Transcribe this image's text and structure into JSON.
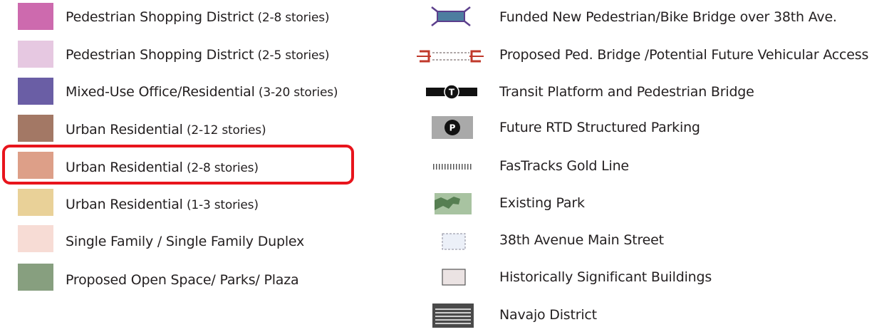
{
  "legend": {
    "left_items": [
      {
        "label": "Pedestrian Shopping District",
        "detail": " (2-8 stories)",
        "color": "#cd6aae"
      },
      {
        "label": "Pedestrian Shopping District",
        "detail": " (2-5 stories)",
        "color": "#e6c8e1"
      },
      {
        "label": "Mixed-Use Office/Residential",
        "detail": " (3-20 stories)",
        "color": "#6a5ea5"
      },
      {
        "label": "Urban Residential",
        "detail": " (2-12 stories)",
        "color": "#a37865"
      },
      {
        "label": "Urban Residential",
        "detail": " (2-8 stories)",
        "color": "#dd9f88"
      },
      {
        "label": "Urban Residential",
        "detail": " (1-3 stories)",
        "color": "#e9d198"
      },
      {
        "label": "Single Family / Single Family Duplex",
        "detail": "",
        "color": "#f7dcd5"
      },
      {
        "label": "Proposed Open Space/ Parks/ Plaza",
        "detail": "",
        "color": "#879f7f"
      }
    ],
    "right_items": [
      {
        "label": "Funded New Pedestrian/Bike Bridge over 38th Ave.",
        "icon": "bridge-icon"
      },
      {
        "label": "Proposed Ped. Bridge /Potential Future Vehicular Access",
        "icon": "proposed-bridge-icon"
      },
      {
        "label": "Transit Platform and Pedestrian Bridge",
        "icon": "transit-platform-icon",
        "icon_text": "T"
      },
      {
        "label": "Future RTD Structured Parking",
        "icon": "parking-icon",
        "icon_text": "P"
      },
      {
        "label": "FasTracks Gold Line",
        "icon": "rail-line-icon"
      },
      {
        "label": "Existing Park",
        "icon": "park-icon"
      },
      {
        "label": "38th Avenue Main Street",
        "icon": "main-street-icon"
      },
      {
        "label": "Historically Significant Buildings",
        "icon": "historic-building-icon"
      },
      {
        "label": "Navajo District",
        "icon": "navajo-district-icon"
      }
    ],
    "highlight_color": "#e8141c"
  }
}
